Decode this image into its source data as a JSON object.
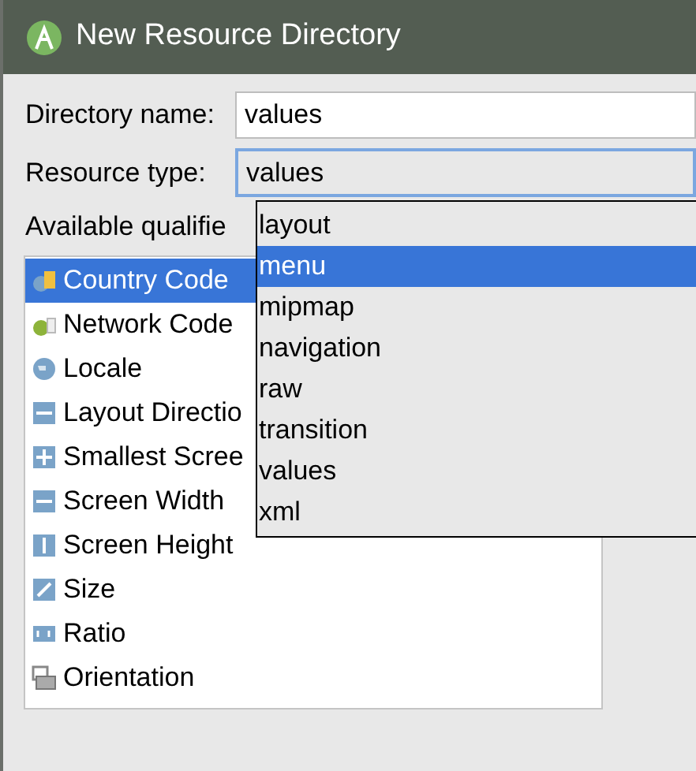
{
  "window": {
    "title": "New Resource Directory"
  },
  "directory_name": {
    "label": "Directory name:",
    "value": "values"
  },
  "resource_type": {
    "label": "Resource type:",
    "value": "values",
    "expanded": true,
    "options": [
      {
        "label": "layout",
        "highlighted": false
      },
      {
        "label": "menu",
        "highlighted": true
      },
      {
        "label": "mipmap",
        "highlighted": false
      },
      {
        "label": "navigation",
        "highlighted": false
      },
      {
        "label": "raw",
        "highlighted": false
      },
      {
        "label": "transition",
        "highlighted": false
      },
      {
        "label": "values",
        "highlighted": false
      },
      {
        "label": "xml",
        "highlighted": false
      }
    ]
  },
  "qualifiers": {
    "label": "Available qualifie",
    "items": [
      {
        "label": "Country Code",
        "kind": "sim",
        "selected": true
      },
      {
        "label": "Network Code",
        "kind": "network",
        "selected": false
      },
      {
        "label": "Locale",
        "kind": "globe",
        "selected": false
      },
      {
        "label": "Layout Directio",
        "kind": "direction",
        "selected": false
      },
      {
        "label": "Smallest Scree",
        "kind": "move",
        "selected": false
      },
      {
        "label": "Screen Width",
        "kind": "width",
        "selected": false
      },
      {
        "label": "Screen Height",
        "kind": "height",
        "selected": false
      },
      {
        "label": "Size",
        "kind": "size",
        "selected": false
      },
      {
        "label": "Ratio",
        "kind": "ratio",
        "selected": false
      },
      {
        "label": "Orientation",
        "kind": "orientation",
        "selected": false
      }
    ]
  }
}
